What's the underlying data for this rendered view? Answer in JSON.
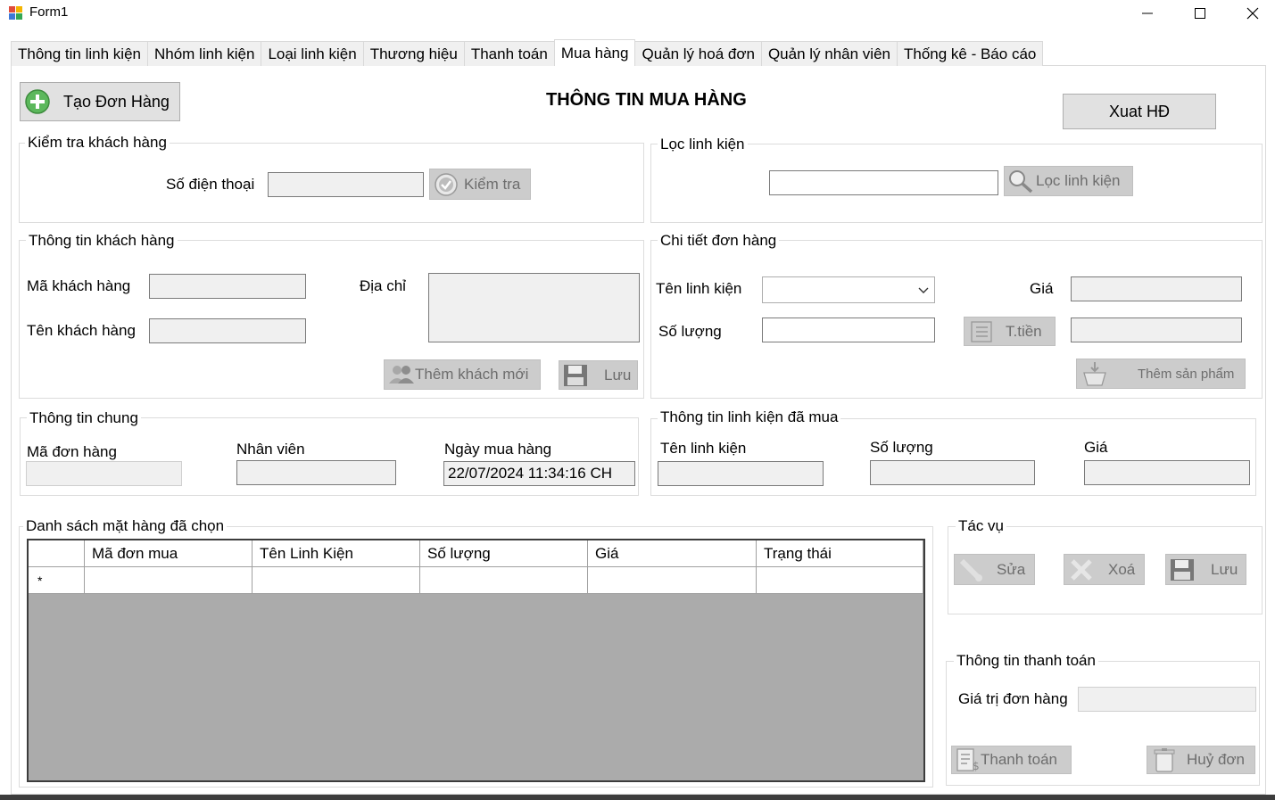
{
  "window": {
    "title": "Form1",
    "minimize": "—",
    "maximize": "☐",
    "close": "✕"
  },
  "tabs": [
    {
      "label": "Thông tin linh kiện"
    },
    {
      "label": "Nhóm linh kiện"
    },
    {
      "label": "Loại linh kiện"
    },
    {
      "label": "Thương hiệu"
    },
    {
      "label": "Thanh toán"
    },
    {
      "label": "Mua hàng"
    },
    {
      "label": "Quản lý hoá đơn"
    },
    {
      "label": "Quản lý nhân viên"
    },
    {
      "label": "Thống kê - Báo cáo"
    }
  ],
  "header": {
    "create_order": "Tạo Đơn Hàng",
    "page_title": "THÔNG TIN MUA HÀNG",
    "export_invoice": "Xuat HĐ"
  },
  "check_customer": {
    "group": "Kiểm tra khách hàng",
    "phone_label": "Số điện thoại",
    "phone_value": "",
    "check_button": "Kiểm tra"
  },
  "filter": {
    "group": "Lọc linh kiện",
    "value": "",
    "button": "Lọc linh kiện"
  },
  "customer_info": {
    "group": "Thông tin khách hàng",
    "code_label": "Mã khách hàng",
    "name_label": "Tên khách hàng",
    "address_label": "Địa chỉ",
    "add_new_button": "Thêm khách mới",
    "save_button": "Lưu"
  },
  "order_detail": {
    "group": "Chi tiết đơn hàng",
    "part_name_label": "Tên linh kiện",
    "price_label": "Giá",
    "qty_label": "Số lượng",
    "total_button": "T.tiền",
    "add_product_button": "Thêm sản phẩm"
  },
  "general_info": {
    "group": "Thông tin chung",
    "order_code_label": "Mã đơn hàng",
    "staff_label": "Nhân viên",
    "date_label": "Ngày mua hàng",
    "date_value": "22/07/2024 11:34:16 CH"
  },
  "bought_info": {
    "group": "Thông tin linh kiện đã mua",
    "part_name_label": "Tên linh kiện",
    "qty_label": "Số lượng",
    "price_label": "Giá"
  },
  "selected_list": {
    "group": "Danh sách mặt hàng đã chọn",
    "columns": [
      "Mã đơn mua",
      "Tên Linh Kiện",
      "Số lượng",
      "Giá",
      "Trạng thái"
    ],
    "new_row_marker": "*"
  },
  "actions": {
    "group": "Tác vụ",
    "edit": "Sửa",
    "delete": "Xoá",
    "save": "Lưu"
  },
  "payment": {
    "group": "Thông tin thanh toán",
    "value_label": "Giá trị đơn hàng",
    "pay_button": "Thanh toán",
    "cancel_button": "Huỷ đơn"
  }
}
